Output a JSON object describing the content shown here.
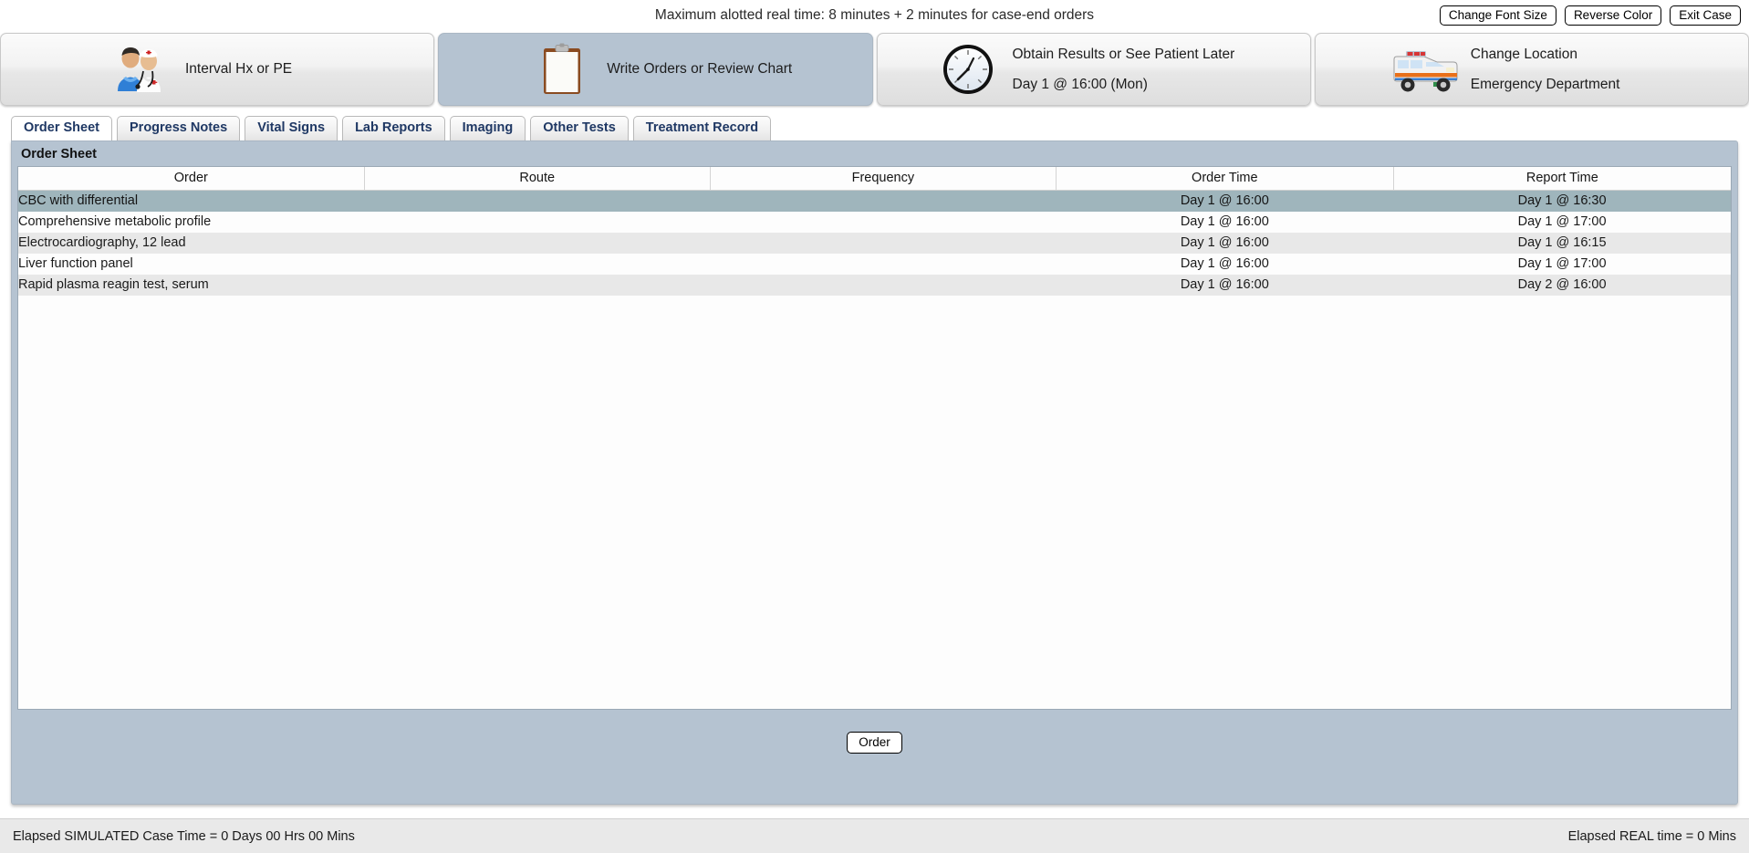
{
  "topbar": {
    "title": "Maximum alotted real time: 8 minutes + 2 minutes for case-end orders",
    "buttons": [
      {
        "label": "Change Font Size",
        "name": "change-font-size-button"
      },
      {
        "label": "Reverse Color",
        "name": "reverse-color-button"
      },
      {
        "label": "Exit Case",
        "name": "exit-case-button"
      }
    ]
  },
  "nav_panels": [
    {
      "label": "Interval Hx or PE",
      "sublabel": "",
      "icon": "patient-doctor-icon",
      "active": false
    },
    {
      "label": "Write Orders or Review Chart",
      "sublabel": "",
      "icon": "clipboard-icon",
      "active": true
    },
    {
      "label": "Obtain Results or See Patient Later",
      "sublabel": "Day 1 @ 16:00 (Mon)",
      "icon": "clock-icon",
      "active": false
    },
    {
      "label": "Change Location",
      "sublabel": "Emergency Department",
      "icon": "ambulance-icon",
      "active": false
    }
  ],
  "tabs": [
    {
      "label": "Order Sheet",
      "active": true
    },
    {
      "label": "Progress Notes",
      "active": false
    },
    {
      "label": "Vital Signs",
      "active": false
    },
    {
      "label": "Lab Reports",
      "active": false
    },
    {
      "label": "Imaging",
      "active": false
    },
    {
      "label": "Other Tests",
      "active": false
    },
    {
      "label": "Treatment Record",
      "active": false
    }
  ],
  "panel": {
    "title": "Order Sheet",
    "order_button": "Order"
  },
  "table": {
    "columns": [
      "Order",
      "Route",
      "Frequency",
      "Order Time",
      "Report Time"
    ],
    "rows": [
      {
        "order": "CBC with differential",
        "route": "",
        "frequency": "",
        "order_time": "Day 1 @ 16:00",
        "report_time": "Day 1 @ 16:30",
        "selected": true
      },
      {
        "order": "Comprehensive metabolic profile",
        "route": "",
        "frequency": "",
        "order_time": "Day 1 @ 16:00",
        "report_time": "Day 1 @ 17:00",
        "selected": false
      },
      {
        "order": "Electrocardiography, 12 lead",
        "route": "",
        "frequency": "",
        "order_time": "Day 1 @ 16:00",
        "report_time": "Day 1 @ 16:15",
        "selected": false
      },
      {
        "order": "Liver function panel",
        "route": "",
        "frequency": "",
        "order_time": "Day 1 @ 16:00",
        "report_time": "Day 1 @ 17:00",
        "selected": false
      },
      {
        "order": "Rapid plasma reagin test, serum",
        "route": "",
        "frequency": "",
        "order_time": "Day 1 @ 16:00",
        "report_time": "Day 2 @ 16:00",
        "selected": false
      }
    ]
  },
  "footer": {
    "left": "Elapsed SIMULATED Case Time = 0 Days 00 Hrs 00 Mins",
    "right": "Elapsed REAL time = 0 Mins"
  },
  "colors": {
    "panel_blue": "#b5c3d1",
    "row_selected": "#9fb5bc",
    "row_alt": "#e8e8e8",
    "tab_text": "#1f3864",
    "footer_bg": "#e9e9e9"
  }
}
